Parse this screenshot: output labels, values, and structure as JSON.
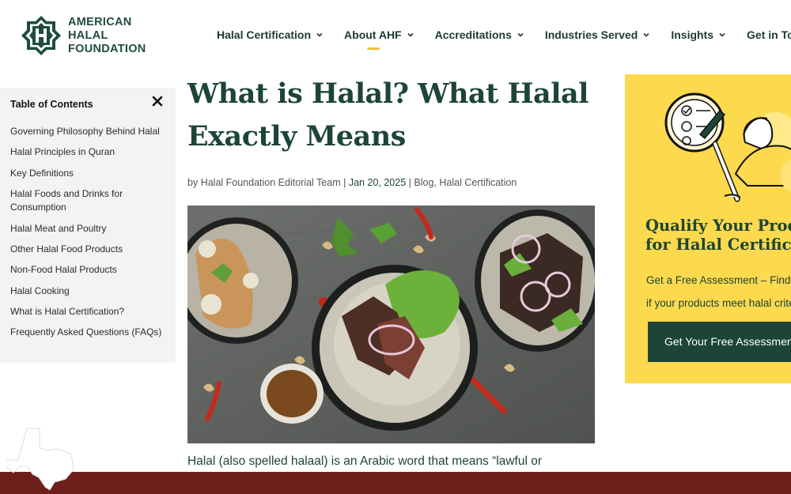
{
  "brand": {
    "name": "AMERICAN HALAL FOUNDATION",
    "name_line1": "AMERICAN HALAL",
    "name_line2": "FOUNDATION",
    "logo_letter": "H",
    "color": "#1f4d3c"
  },
  "nav": {
    "items": [
      {
        "label": "Halal Certification",
        "active": false
      },
      {
        "label": "About AHF",
        "active": true
      },
      {
        "label": "Accreditations",
        "active": false
      },
      {
        "label": "Industries Served",
        "active": false
      },
      {
        "label": "Insights",
        "active": false
      },
      {
        "label": "Get in Touch",
        "active": false
      }
    ],
    "accent_color": "#f2c230"
  },
  "toc": {
    "title": "Table of Contents",
    "items": [
      "Governing Philosophy Behind Halal",
      "Halal Principles in Quran",
      "Key Definitions",
      "Halal Foods and Drinks for Consumption",
      "Halal Meat and Poultry",
      "Other Halal Food Products",
      "Non-Food Halal Products",
      "Halal Cooking",
      "What is Halal Certification?",
      "Frequently Asked Questions (FAQs)"
    ]
  },
  "article": {
    "title": "What is Halal? What Halal Exactly Means",
    "byline_prefix": "by",
    "author": "Halal Foundation Editorial Team",
    "separator": "|",
    "date": "Jan 20, 2025",
    "category_1": "Blog",
    "category_sep": ",",
    "category_2": "Halal Certification",
    "intro": "Halal (also spelled halaal) is an Arabic word that means “lawful or"
  },
  "promo": {
    "heading_line1": "Qualify Your Products",
    "heading_line2": "for Halal Certification",
    "text_line1": "Get a Free Assessment – Find out",
    "text_line2": "if your products meet halal criteria",
    "button_label": "Get Your Free Assessment",
    "background": "#fcd94d",
    "button_color": "#1d4535"
  },
  "footer": {
    "band_color": "#6e1f1c"
  }
}
